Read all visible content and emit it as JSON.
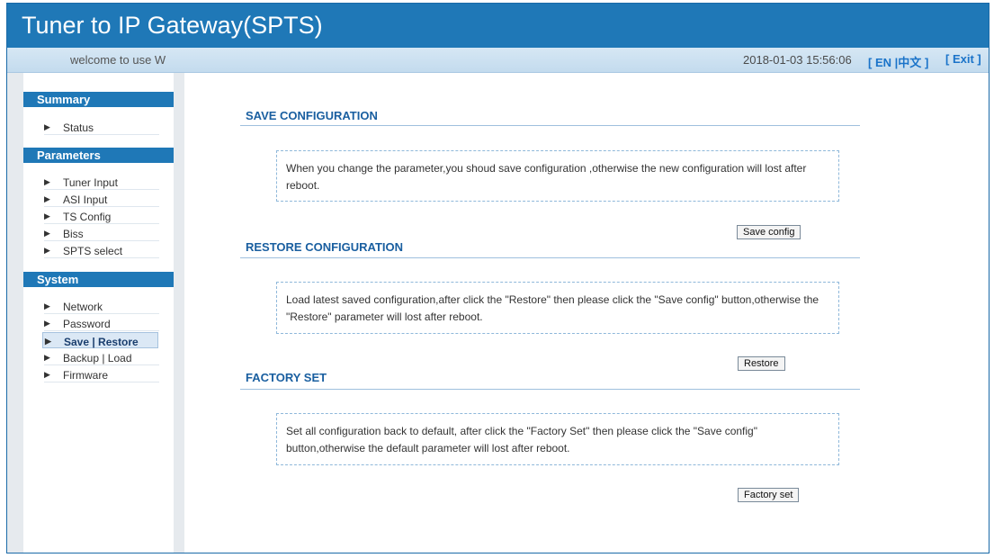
{
  "header": {
    "title": "Tuner to IP Gateway(SPTS)"
  },
  "subbar": {
    "welcome": "welcome to use W",
    "datetime": "2018-01-03 15:56:06",
    "lang_open": "[",
    "lang_en": "EN",
    "lang_sep": "|",
    "lang_zh": "中文",
    "lang_close": "]",
    "exit": "[ Exit ]"
  },
  "sidebar": {
    "summary": {
      "title": "Summary",
      "items": [
        "Status"
      ]
    },
    "parameters": {
      "title": "Parameters",
      "items": [
        "Tuner Input",
        "ASI Input",
        "TS Config",
        "Biss",
        "SPTS select"
      ]
    },
    "system": {
      "title": "System",
      "items": [
        "Network",
        "Password",
        "Save | Restore",
        "Backup | Load",
        "Firmware"
      ],
      "active": "Save | Restore"
    }
  },
  "content": {
    "save": {
      "title": "SAVE CONFIGURATION",
      "text": "When you change the parameter,you shoud save configuration ,otherwise the new configuration will lost after reboot.",
      "button": "Save config"
    },
    "restore": {
      "title": "RESTORE CONFIGURATION",
      "text": "Load latest saved configuration,after click the \"Restore\" then please click the \"Save config\" button,otherwise the \"Restore\" parameter will lost after reboot.",
      "button": "Restore"
    },
    "factory": {
      "title": "FACTORY SET",
      "text": "Set all configuration back to default, after click the \"Factory Set\" then please click the \"Save config\" button,otherwise the default parameter will lost after reboot.",
      "button": "Factory set"
    }
  },
  "colors": {
    "brand": "#1f78b7",
    "link": "#1a73c9",
    "title": "#1a5fa0"
  },
  "icons": {
    "nav_arrow": "triangle-right-icon"
  }
}
